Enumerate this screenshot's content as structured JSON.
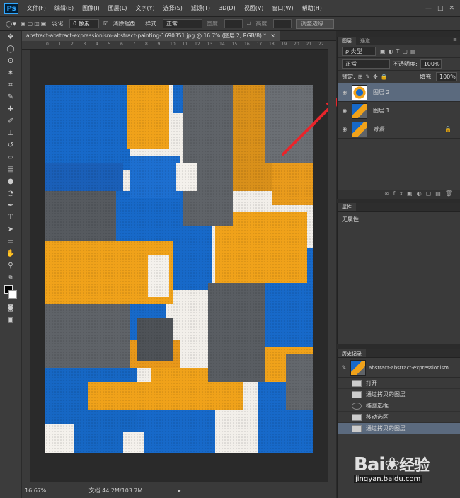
{
  "menubar": {
    "logo": "Ps",
    "items": [
      "文件(F)",
      "编辑(E)",
      "图像(I)",
      "图层(L)",
      "文字(Y)",
      "选择(S)",
      "滤镜(T)",
      "3D(D)",
      "视图(V)",
      "窗口(W)",
      "帮助(H)"
    ],
    "min": "—",
    "max": "□",
    "close": "✕"
  },
  "options": {
    "feather_label": "羽化:",
    "feather_value": "0 像素",
    "antialias_label": "消除锯齿",
    "style_label": "样式:",
    "style_value": "正常",
    "width_label": "宽度:",
    "height_label": "高度:",
    "refine_button": "调整边缘..."
  },
  "document": {
    "tab_title": "abstract-abstract-expressionism-abstract-painting-1690351.jpg @ 16.7% (图层 2, RGB/8) *",
    "tab_close": "×",
    "ruler_ticks": [
      "0",
      "1",
      "2",
      "3",
      "4",
      "5",
      "6",
      "7",
      "8",
      "9",
      "10",
      "11",
      "12",
      "13",
      "14",
      "15",
      "16",
      "17",
      "18",
      "19",
      "20",
      "21",
      "22"
    ]
  },
  "status": {
    "zoom": "16.67%",
    "doc_size": "文档:44.2M/103.7M"
  },
  "layers_panel": {
    "tabs": [
      "图层",
      "通道"
    ],
    "filter_label": "ρ 类型",
    "blend_mode": "正常",
    "opacity_label": "不透明度:",
    "opacity_value": "100%",
    "lock_label": "锁定:",
    "fill_label": "填充:",
    "fill_value": "100%",
    "layers": [
      {
        "name": "图层 2",
        "selected": true
      },
      {
        "name": "图层 1",
        "selected": false
      },
      {
        "name": "背景",
        "selected": false,
        "locked": true
      }
    ]
  },
  "properties_panel": {
    "tab": "属性",
    "content": "无属性"
  },
  "history_panel": {
    "tab": "历史记录",
    "snapshot_name": "abstract-abstract-expressionism...",
    "items": [
      {
        "label": "打开",
        "selected": false
      },
      {
        "label": "通过拷贝的图层",
        "selected": false
      },
      {
        "label": "椭圆选框",
        "selected": false
      },
      {
        "label": "移动选区",
        "selected": false
      },
      {
        "label": "通过拷贝的图层",
        "selected": true
      }
    ]
  },
  "watermark": {
    "brand": "Bai",
    "brand2": "经验",
    "url": "jingyan.baidu.com"
  },
  "colors": {
    "blue": "#1769c9",
    "orange": "#f0a21a",
    "gray": "#5f6368",
    "arrow": "#e8252b"
  }
}
